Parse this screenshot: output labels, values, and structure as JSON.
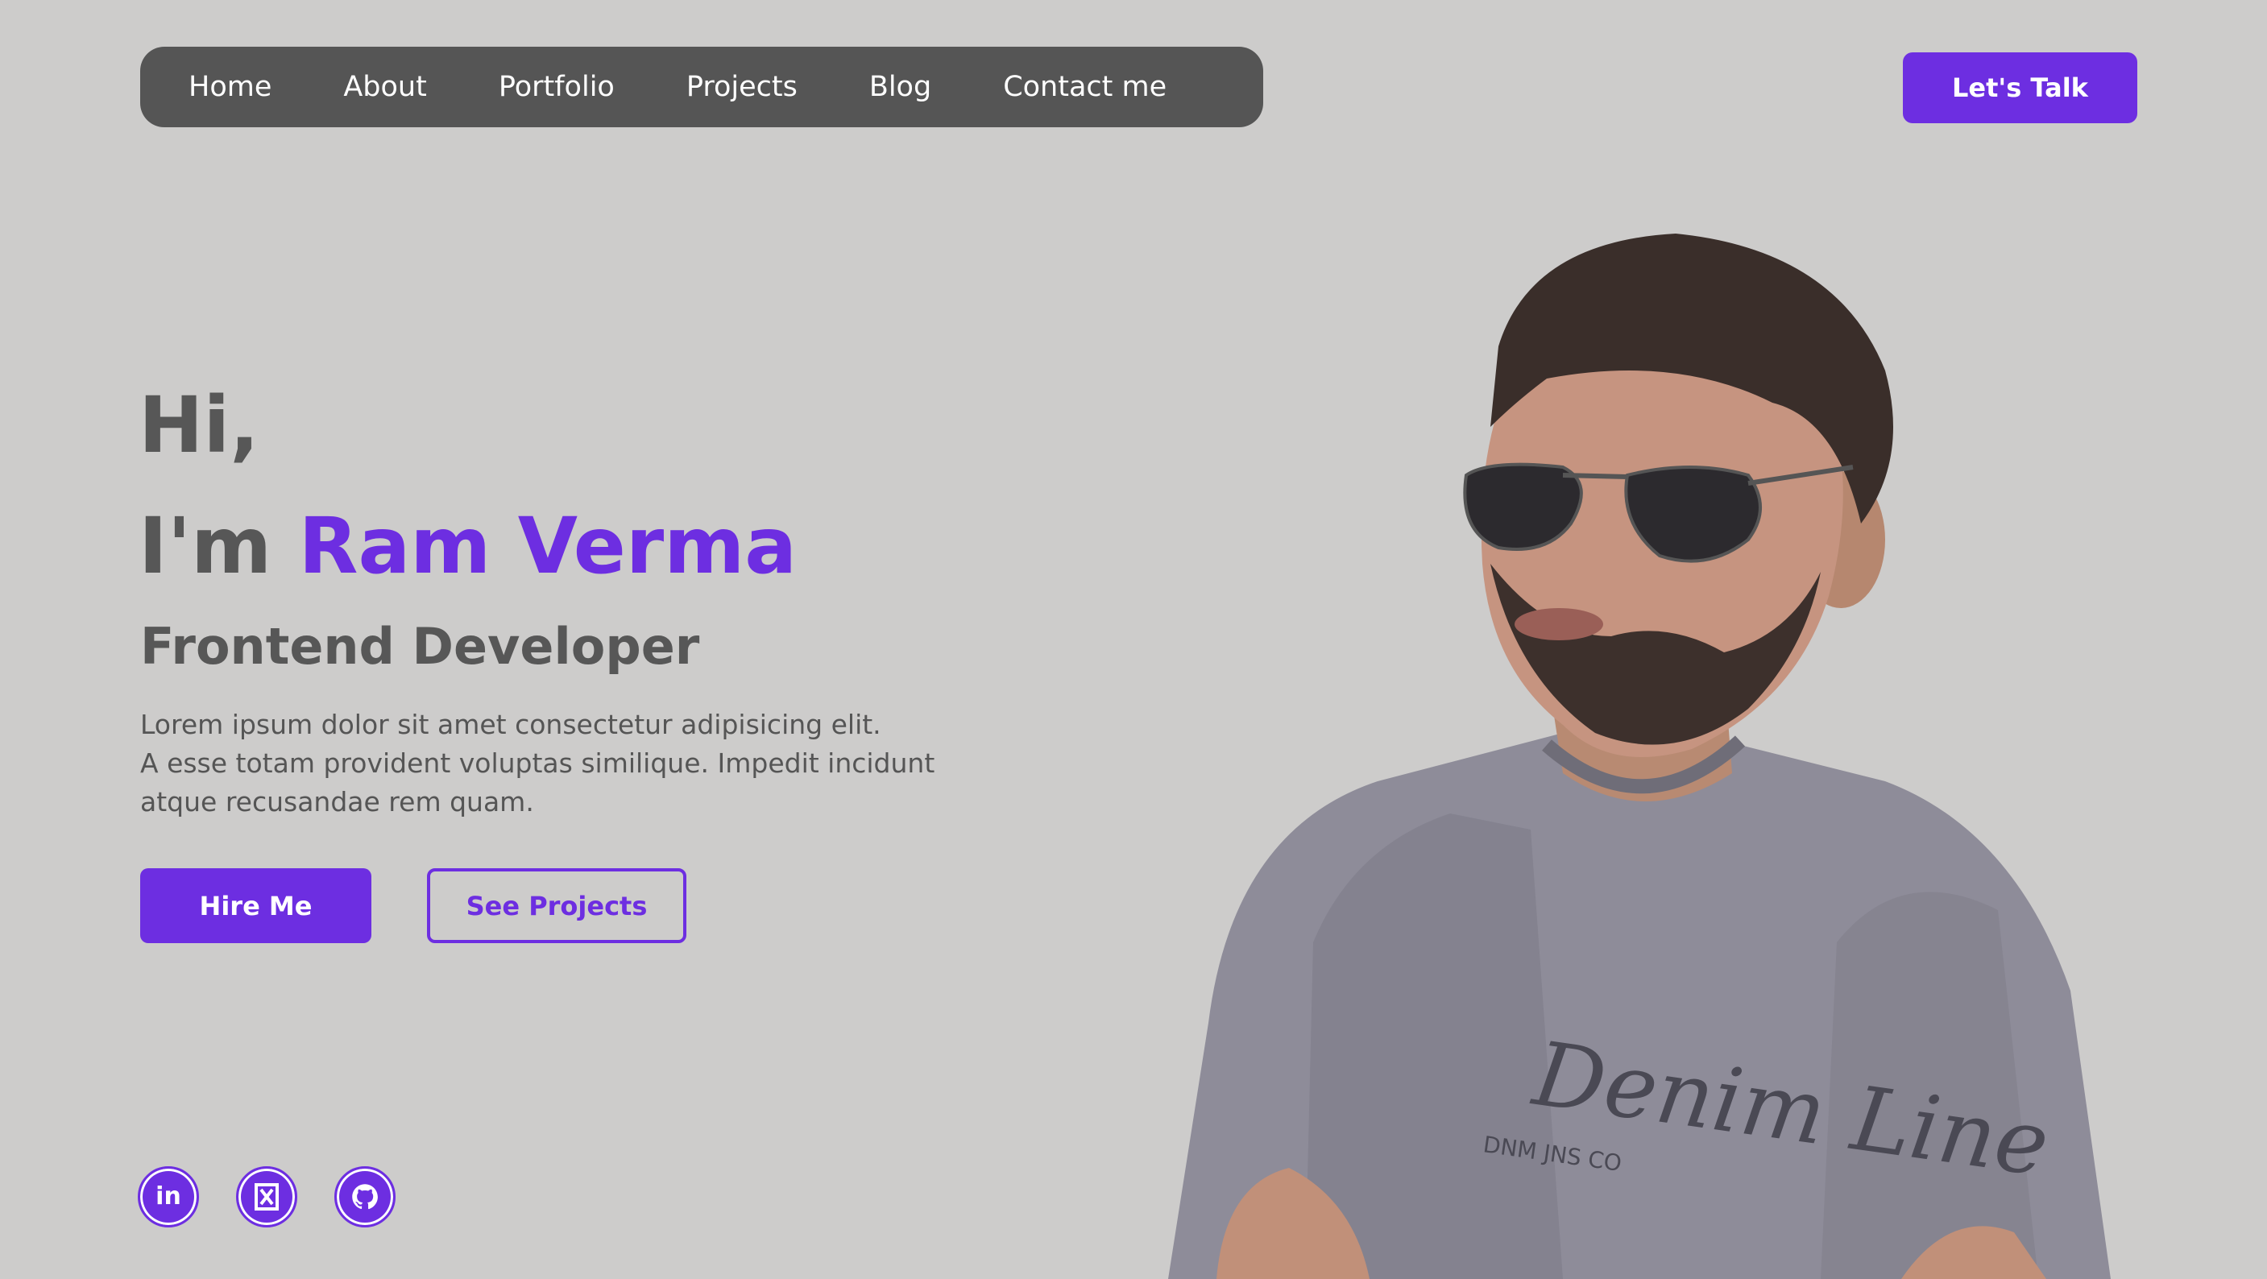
{
  "nav": {
    "items": [
      {
        "label": "Home"
      },
      {
        "label": "About"
      },
      {
        "label": "Portfolio"
      },
      {
        "label": "Projects"
      },
      {
        "label": "Blog"
      },
      {
        "label": "Contact me"
      }
    ],
    "cta_label": "Let's Talk"
  },
  "hero": {
    "greeting": "Hi,",
    "intro_prefix": "I'm ",
    "name": "Ram Verma",
    "role": "Frontend Developer",
    "description_lines": [
      "Lorem ipsum dolor sit amet consectetur adipisicing elit.",
      "A esse totam provident voluptas similique. Impedit incidunt",
      "atque recusandae rem quam."
    ],
    "hire_label": "Hire Me",
    "projects_label": "See Projects"
  },
  "social": [
    {
      "icon": "linkedin-icon",
      "text": "in"
    },
    {
      "icon": "x-icon"
    },
    {
      "icon": "github-icon"
    }
  ],
  "portrait": {
    "shirt_print": "Denim Line",
    "shirt_small_print": "DNM JNS CO"
  },
  "colors": {
    "background": "#cdcccb",
    "accent": "#6d2ee1",
    "nav_bg": "#555555",
    "text_dark": "#575757"
  }
}
